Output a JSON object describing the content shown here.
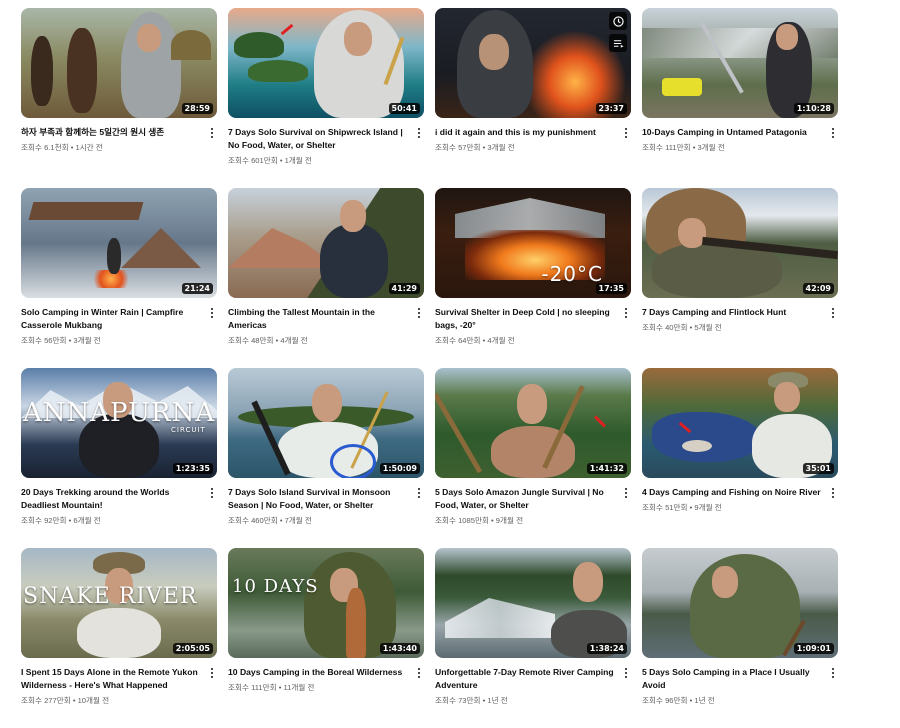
{
  "videos": [
    {
      "title": "하자 부족과 함께하는 5일간의 원시 생존",
      "stats": "조회수 6.1천회 • 1시간 전",
      "duration": "28:59",
      "thumb": "hadza"
    },
    {
      "title": "7 Days Solo Survival on Shipwreck Island | No Food, Water, or Shelter",
      "stats": "조회수 601만회 • 1개월 전",
      "duration": "50:41",
      "thumb": "island"
    },
    {
      "title": "i did it again and this is my punishment",
      "stats": "조회수 57만회 • 3개월 전",
      "duration": "23:37",
      "thumb": "fire-night"
    },
    {
      "title": "10-Days Camping in Untamed Patagonia",
      "stats": "조회수 111만회 • 3개월 전",
      "duration": "1:10:28",
      "thumb": "patagonia"
    },
    {
      "title": "Solo Camping in Winter Rain | Campfire Casserole Mukbang",
      "stats": "조회수 56만회 • 3개월 전",
      "duration": "21:24",
      "thumb": "winter-rain"
    },
    {
      "title": "Climbing the Tallest Mountain in the Americas",
      "stats": "조회수 48만회 • 4개월 전",
      "duration": "41:29",
      "thumb": "tent"
    },
    {
      "title": "Survival Shelter in Deep Cold | no sleeping bags, -20°",
      "stats": "조회수 64만회 • 4개월 전",
      "duration": "17:35",
      "thumb": "deep-cold"
    },
    {
      "title": "7 Days Camping and Flintlock Hunt",
      "stats": "조회수 40만회 • 5개월 전",
      "duration": "42:09",
      "thumb": "flintlock"
    },
    {
      "title": "20 Days Trekking around the Worlds Deadliest Mountain!",
      "stats": "조회수 92만회 • 6개월 전",
      "duration": "1:23:35",
      "thumb": "annapurna"
    },
    {
      "title": "7 Days Solo Island Survival in Monsoon Season | No Food, Water, or Shelter",
      "stats": "조회수 460만회 • 7개월 전",
      "duration": "1:50:09",
      "thumb": "monsoon"
    },
    {
      "title": "5 Days Solo Amazon Jungle Survival | No Food, Water, or Shelter",
      "stats": "조회수 1085만회 • 9개월 전",
      "duration": "1:41:32",
      "thumb": "amazon"
    },
    {
      "title": "4 Days Camping and Fishing on Noire River",
      "stats": "조회수 51만회 • 9개월 전",
      "duration": "35:01",
      "thumb": "noire"
    },
    {
      "title": "I Spent 15 Days Alone in the Remote Yukon Wilderness - Here's What Happened",
      "stats": "조회수 277만회 • 10개월 전",
      "duration": "2:05:05",
      "thumb": "yukon"
    },
    {
      "title": "10 Days Camping in the Boreal Wilderness",
      "stats": "조회수 111만회 • 11개월 전",
      "duration": "1:43:40",
      "thumb": "boreal"
    },
    {
      "title": "Unforgettable 7-Day Remote River Camping Adventure",
      "stats": "조회수 73만회 • 1년 전",
      "duration": "1:38:24",
      "thumb": "river"
    },
    {
      "title": "5 Days Solo Camping in a Place I Usually Avoid",
      "stats": "조회수 96만회 • 1년 전",
      "duration": "1:09:01",
      "thumb": "avoid"
    }
  ],
  "overlays": {
    "annapurna": "ANNAPURNA",
    "annapurna_sub": "CIRCUIT",
    "yukon": "SNAKE RIVER",
    "boreal": "10 DAYS",
    "deep_cold": "-20°C"
  },
  "icons": {
    "menu": "more-vert-icon",
    "watch_later": "clock-icon",
    "add_to_queue": "queue-icon"
  }
}
